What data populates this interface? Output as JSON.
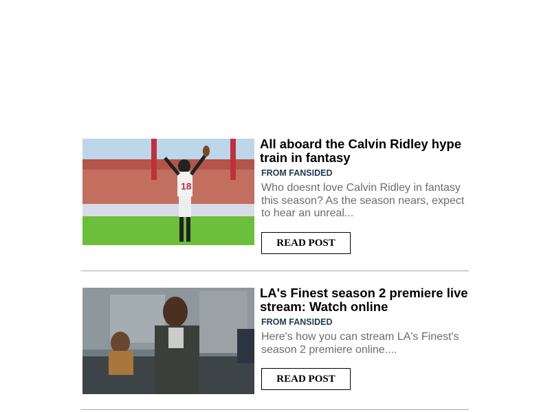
{
  "posts": [
    {
      "title": "All aboard the Calvin Ridley hype train in fantasy",
      "source": "FROM FANSIDED",
      "description": "Who doesnt love Calvin Ridley in fantasy this season? As the season nears, expect to hear an unreal...",
      "button": "READ POST",
      "image": "football-player-photo"
    },
    {
      "title": "LA's Finest season 2 premiere live stream: Watch online",
      "source": "FROM FANSIDED",
      "description": "Here's how you can stream LA's Finest's season 2 premiere online....",
      "button": "READ POST",
      "image": "tv-show-scene-photo"
    }
  ]
}
